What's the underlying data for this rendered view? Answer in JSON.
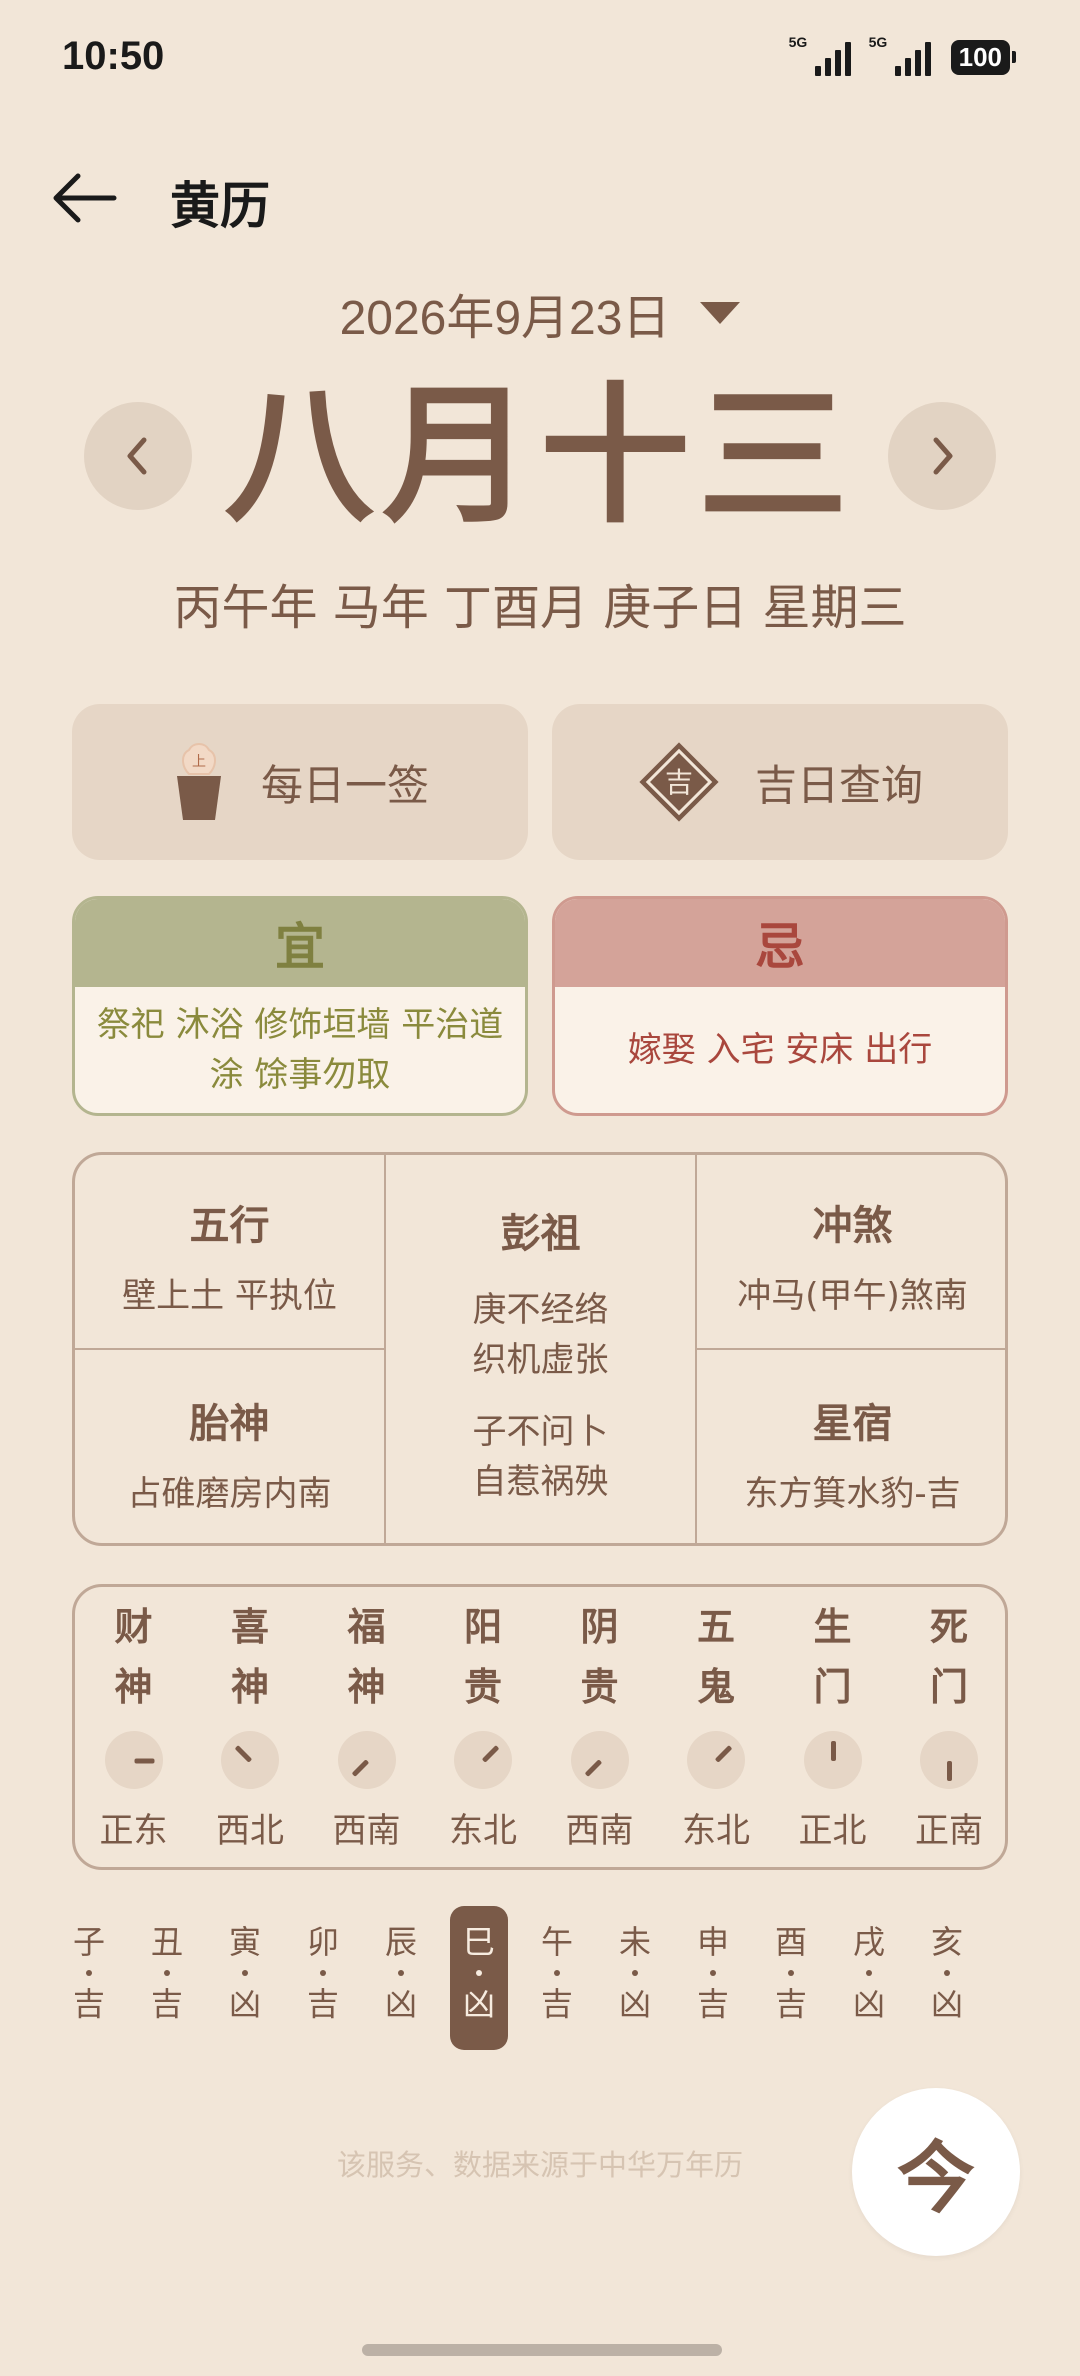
{
  "status_bar": {
    "time": "10:50",
    "signal1_label": "5G",
    "signal2_label": "5G",
    "battery": "100"
  },
  "header": {
    "title": "黄历"
  },
  "date_picker": {
    "date": "2026年9月23日"
  },
  "lunar": {
    "big": "八月十三",
    "ganzhi": "丙午年 马年 丁酉月 庚子日 星期三"
  },
  "quick_actions": {
    "daily_lot": "每日一签",
    "lucky_day": "吉日查询",
    "lucky_char": "吉",
    "lot_char": "上"
  },
  "yi": {
    "title": "宜",
    "items": "祭祀 沐浴 修饰垣墙 平治道涂 馀事勿取"
  },
  "ji": {
    "title": "忌",
    "items": "嫁娶 入宅 安床 出行"
  },
  "info": {
    "wuxing": {
      "title": "五行",
      "value": "壁上土 平执位"
    },
    "pengzu": {
      "title": "彭祖",
      "line1": "庚不经络",
      "line2": "织机虚张",
      "line3": "子不问卜",
      "line4": "自惹祸殃"
    },
    "chongsha": {
      "title": "冲煞",
      "value": "冲马(甲午)煞南"
    },
    "taishen": {
      "title": "胎神",
      "value": "占碓磨房内南"
    },
    "xingxiu": {
      "title": "星宿",
      "value": "东方箕水豹-吉"
    }
  },
  "directions": [
    {
      "n1": "财",
      "n2": "神",
      "dir": "正东",
      "angle": 90
    },
    {
      "n1": "喜",
      "n2": "神",
      "dir": "西北",
      "angle": -45
    },
    {
      "n1": "福",
      "n2": "神",
      "dir": "西南",
      "angle": -135
    },
    {
      "n1": "阳",
      "n2": "贵",
      "dir": "东北",
      "angle": 45
    },
    {
      "n1": "阴",
      "n2": "贵",
      "dir": "西南",
      "angle": -135
    },
    {
      "n1": "五",
      "n2": "鬼",
      "dir": "东北",
      "angle": 45
    },
    {
      "n1": "生",
      "n2": "门",
      "dir": "正北",
      "angle": 0
    },
    {
      "n1": "死",
      "n2": "门",
      "dir": "正南",
      "angle": 180
    }
  ],
  "hours": [
    {
      "zhi": "子",
      "luck": "吉"
    },
    {
      "zhi": "丑",
      "luck": "吉"
    },
    {
      "zhi": "寅",
      "luck": "凶"
    },
    {
      "zhi": "卯",
      "luck": "吉"
    },
    {
      "zhi": "辰",
      "luck": "凶"
    },
    {
      "zhi": "巳",
      "luck": "凶"
    },
    {
      "zhi": "午",
      "luck": "吉"
    },
    {
      "zhi": "未",
      "luck": "凶"
    },
    {
      "zhi": "申",
      "luck": "吉"
    },
    {
      "zhi": "酉",
      "luck": "吉"
    },
    {
      "zhi": "戌",
      "luck": "凶"
    },
    {
      "zhi": "亥",
      "luck": "凶"
    }
  ],
  "selected_hour": "巳",
  "footer": {
    "source": "该服务、数据来源于中华万年历",
    "today": "今"
  }
}
